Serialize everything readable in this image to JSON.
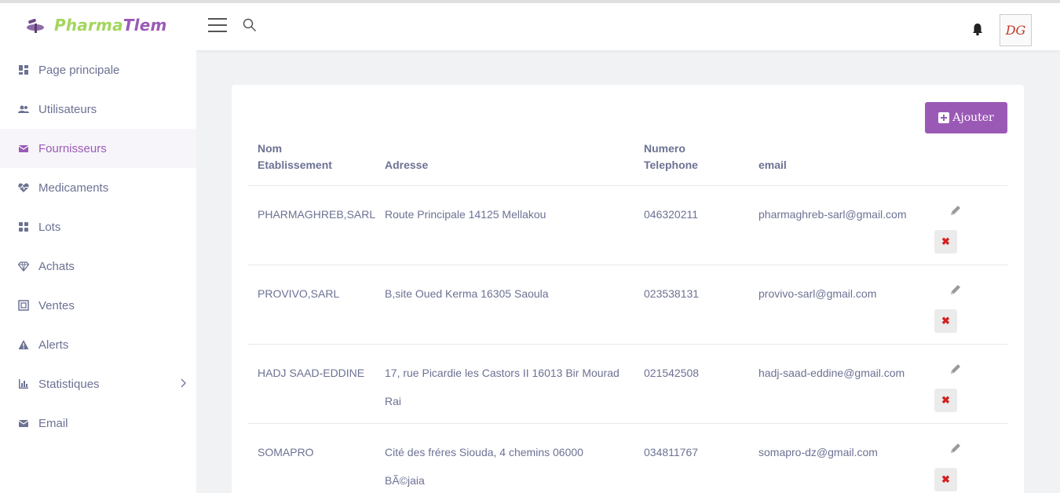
{
  "brand": {
    "name_part1": "Pharma",
    "name_part2": "Tlem"
  },
  "header": {
    "avatar_initials": "DG"
  },
  "sidebar": {
    "items": [
      {
        "label": "Page principale",
        "icon": "dashboard-icon"
      },
      {
        "label": "Utilisateurs",
        "icon": "users-icon"
      },
      {
        "label": "Fournisseurs",
        "icon": "envelope-icon"
      },
      {
        "label": "Medicaments",
        "icon": "heartbeat-icon"
      },
      {
        "label": "Lots",
        "icon": "grid-icon"
      },
      {
        "label": "Achats",
        "icon": "diamond-icon"
      },
      {
        "label": "Ventes",
        "icon": "box-icon"
      },
      {
        "label": "Alerts",
        "icon": "warning-icon"
      },
      {
        "label": "Statistiques",
        "icon": "bar-chart-icon"
      },
      {
        "label": "Email",
        "icon": "mail-icon"
      }
    ]
  },
  "main": {
    "add_label": "Ajouter",
    "columns": {
      "nom_line1": "Nom",
      "nom_line2": "Etablissement",
      "adresse": "Adresse",
      "tel_line1": "Numero",
      "tel_line2": "Telephone",
      "email": "email"
    },
    "rows": [
      {
        "nom": "PHARMAGHREB,SARL",
        "adresse": "Route Principale 14125 Mellakou",
        "tel": "046320211",
        "email": "pharmaghreb-sarl@gmail.com"
      },
      {
        "nom": "PROVIVO,SARL",
        "adresse": "B,site Oued Kerma 16305 Saoula",
        "tel": "023538131",
        "email": "provivo-sarl@gmail.com"
      },
      {
        "nom": "HADJ SAAD-EDDINE",
        "adresse": "17, rue Picardie les Castors II 16013 Bir Mourad Rai",
        "tel": "021542508",
        "email": "hadj-saad-eddine@gmail.com"
      },
      {
        "nom": "SOMAPRO",
        "adresse": "Cité des fréres Siouda, 4 chemins 06000 BÃ©jaia",
        "tel": "034811767",
        "email": "somapro-dz@gmail.com"
      }
    ]
  },
  "colors": {
    "accent": "#9b59b6",
    "brand_green": "#a3d65c",
    "danger": "#d62020"
  }
}
